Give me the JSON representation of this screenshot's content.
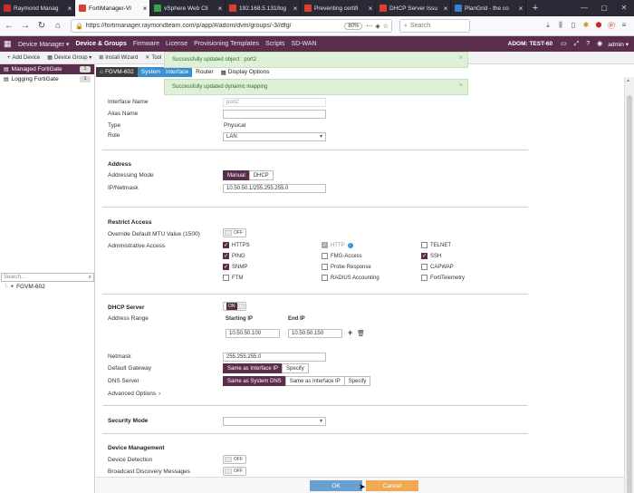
{
  "browser": {
    "tabs": [
      {
        "title": "Raymond Manag",
        "color": "#c9302c"
      },
      {
        "title": "FortiManager-VI",
        "color": "#d9402e",
        "active": true
      },
      {
        "title": "vSphere Web Cli",
        "color": "#3aa04a"
      },
      {
        "title": "192.168.5.131/log",
        "color": "#d9402e"
      },
      {
        "title": "Preventing certifi",
        "color": "#d9402e"
      },
      {
        "title": "DHCP Server Issu",
        "color": "#d9402e"
      },
      {
        "title": "PlanGrid - the co",
        "color": "#3a7fd0"
      }
    ],
    "new_tab": "+",
    "url": "https://fortimanager.raymondteam.com/p/app/#/adom/dvm/groups/-3//dfg/",
    "zoom": "80%",
    "search_placeholder": "Search"
  },
  "header": {
    "menus": [
      "Device Manager ▾",
      "Device & Groups",
      "Firmware",
      "License",
      "Provisioning Templates",
      "Scripts",
      "SD-WAN"
    ],
    "active_menu": "Device & Groups",
    "adom": "ADOM: TEST-60",
    "user": "admin ▾"
  },
  "toolbar": {
    "items": [
      {
        "icon": "+",
        "label": "Add Device"
      },
      {
        "icon": "▦",
        "label": "Device Group ▾"
      },
      {
        "icon": "⊞",
        "label": "Install Wizard"
      },
      {
        "icon": "✕",
        "label": "Tool"
      }
    ]
  },
  "sidebar": {
    "items": [
      {
        "label": "Managed FortiGate",
        "count": "1",
        "selected": true
      },
      {
        "label": "Logging FortiGate",
        "count": "1",
        "selected": false
      }
    ],
    "search_placeholder": "Search...",
    "tree_device": "FGVM-602"
  },
  "content_tabs": {
    "device": "FGVM-602",
    "tabs": [
      "System : Interface",
      "Router",
      "Display Options"
    ]
  },
  "toasts": [
    "Successfully updated object : port2",
    "Successfully updated dynamic mapping"
  ],
  "form": {
    "interface_name_label": "Interface Name",
    "interface_name": "port2",
    "alias_label": "Alias Name",
    "alias": "",
    "type_label": "Type",
    "type": "Physical",
    "role_label": "Role",
    "role": "LAN",
    "address_section": "Address",
    "addressing_mode_label": "Addressing Mode",
    "addressing_modes": [
      "Manual",
      "DHCP"
    ],
    "ipmask_label": "IP/Netmask",
    "ipmask": "10.50.50.1/255.255.255.0",
    "restrict_section": "Restrict Access",
    "mtu_label": "Override Default MTU Value (1500)",
    "mtu_toggle": "OFF",
    "admin_access_label": "Administrative Access",
    "access": [
      {
        "label": "HTTPS",
        "checked": true
      },
      {
        "label": "HTTP",
        "checked": true,
        "disabled": true
      },
      {
        "label": "TELNET",
        "checked": false
      },
      {
        "label": "PING",
        "checked": true
      },
      {
        "label": "FMG-Access",
        "checked": false
      },
      {
        "label": "SSH",
        "checked": true
      },
      {
        "label": "SNMP",
        "checked": true
      },
      {
        "label": "Probe Response",
        "checked": false
      },
      {
        "label": "CAPWAP",
        "checked": false
      },
      {
        "label": "FTM",
        "checked": false
      },
      {
        "label": "RADIUS Accounting",
        "checked": false
      },
      {
        "label": "FortiTelemetry",
        "checked": false
      }
    ],
    "dhcp_section": "DHCP Server",
    "dhcp_toggle": "ON",
    "address_range_label": "Address Range",
    "starting_ip_label": "Starting IP",
    "end_ip_label": "End IP",
    "starting_ip": "10.50.50.100",
    "end_ip": "10.50.50.150",
    "netmask_label": "Netmask",
    "netmask": "255.255.255.0",
    "gateway_label": "Default Gateway",
    "gateway_options": [
      "Same as Interface IP",
      "Specify"
    ],
    "dns_label": "DNS Server",
    "dns_options": [
      "Same as System DNS",
      "Same as Interface IP",
      "Specify"
    ],
    "advanced_label": "Advanced Options",
    "security_section": "Security Mode",
    "security_mode": "",
    "devmgmt_section": "Device Management",
    "device_detection_label": "Device Detection",
    "device_detection": "OFF",
    "broadcast_label": "Broadcast Discovery Messages",
    "broadcast": "OFF"
  },
  "footer": {
    "ok": "OK",
    "cancel": "Cancel"
  },
  "colors": {
    "brand": "#5b2d4d",
    "accent": "#3a8fcf",
    "ok": "#6aa0cf",
    "cancel": "#f0a955",
    "toast": "#dff0d8"
  }
}
